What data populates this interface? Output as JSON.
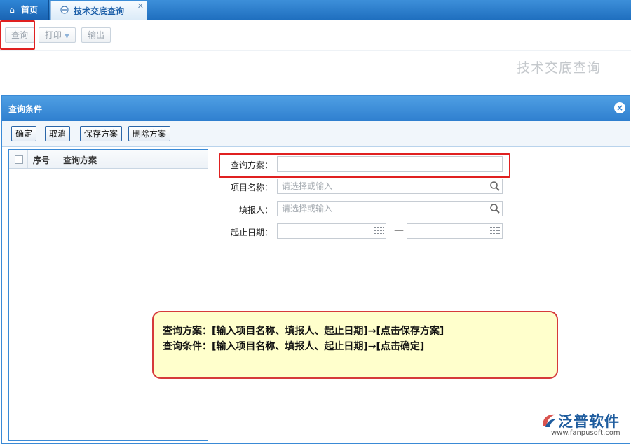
{
  "tabs": [
    {
      "label": "首页",
      "icon": "home-icon",
      "active": false
    },
    {
      "label": "技术交底查询",
      "icon": "page-icon",
      "active": true
    }
  ],
  "toolbar": {
    "query_label": "查询",
    "print_label": "打印",
    "export_label": "输出"
  },
  "page": {
    "heading": "技术交底查询"
  },
  "dialog": {
    "title": "查询条件",
    "buttons": {
      "ok": "确定",
      "cancel": "取消",
      "save": "保存方案",
      "delete": "删除方案"
    },
    "list": {
      "columns": [
        "序号",
        "查询方案"
      ],
      "rows": []
    },
    "form": {
      "plan": {
        "label": "查询方案：",
        "value": ""
      },
      "project": {
        "label": "项目名称：",
        "placeholder": "请选择或输入"
      },
      "reporter": {
        "label": "填报人：",
        "placeholder": "请选择或输入"
      },
      "date": {
        "label": "起止日期：",
        "separator": "—"
      }
    }
  },
  "callout": {
    "line1": "查询方案：[输入项目名称、填报人、起止日期]→[点击保存方案]",
    "line2": "查询条件：[输入项目名称、填报人、起止日期]→[点击确定]"
  },
  "logo": {
    "name": "泛普软件",
    "url": "www.fanpusoft.com"
  },
  "colors": {
    "accent": "#2f7fcf",
    "highlight": "#e02020",
    "callout_bg": "#ffffcc"
  }
}
